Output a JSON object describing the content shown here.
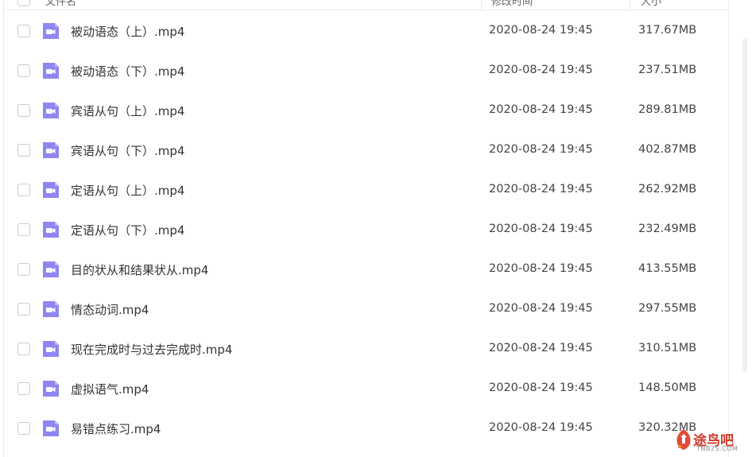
{
  "header": {
    "columns": [
      "文件名",
      "修改时间",
      "大小"
    ]
  },
  "files": [
    {
      "name": "被动语态（上）.mp4",
      "date": "2020-08-24 19:45",
      "size": "317.67MB"
    },
    {
      "name": "被动语态（下）.mp4",
      "date": "2020-08-24 19:45",
      "size": "237.51MB"
    },
    {
      "name": "宾语从句（上）.mp4",
      "date": "2020-08-24 19:45",
      "size": "289.81MB"
    },
    {
      "name": "宾语从句（下）.mp4",
      "date": "2020-08-24 19:45",
      "size": "402.87MB"
    },
    {
      "name": "定语从句（上）.mp4",
      "date": "2020-08-24 19:45",
      "size": "262.92MB"
    },
    {
      "name": "定语从句（下）.mp4",
      "date": "2020-08-24 19:45",
      "size": "232.49MB"
    },
    {
      "name": "目的状从和结果状从.mp4",
      "date": "2020-08-24 19:45",
      "size": "413.55MB"
    },
    {
      "name": "情态动词.mp4",
      "date": "2020-08-24 19:45",
      "size": "297.55MB"
    },
    {
      "name": "现在完成时与过去完成时.mp4",
      "date": "2020-08-24 19:45",
      "size": "310.51MB"
    },
    {
      "name": "虚拟语气.mp4",
      "date": "2020-08-24 19:45",
      "size": "148.50MB"
    },
    {
      "name": "易错点练习.mp4",
      "date": "2020-08-24 19:45",
      "size": "320.32MB"
    }
  ],
  "file_icon": "video-file-icon",
  "colors": {
    "icon_bg": "#8f87f1",
    "text": "#333333",
    "watermark_red": "#d23a2a"
  },
  "watermark": {
    "text": "途鸟吧",
    "sub": "TNB2S.COM"
  }
}
